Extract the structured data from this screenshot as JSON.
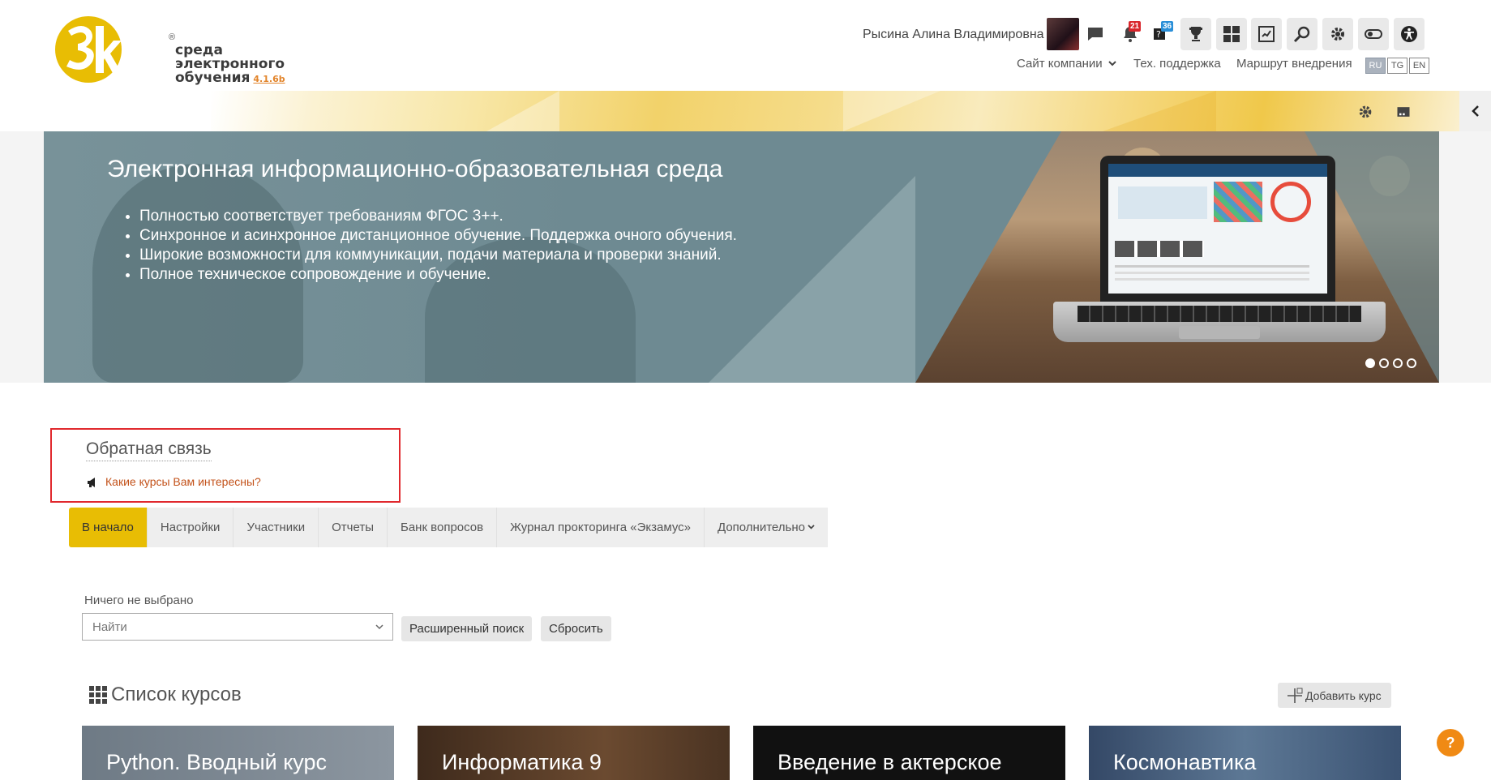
{
  "header": {
    "logo": {
      "line1": "среда",
      "line2": "электронного",
      "line3": "обучения",
      "version": "4.1.6b",
      "reg_mark": "®"
    },
    "user_name": "Рысина Алина Владимировна",
    "notifications_count": "21",
    "messages_count": "36",
    "nav": {
      "company_site": "Сайт компании",
      "tech_support": "Тех. поддержка",
      "implementation_route": "Маршрут внедрения"
    },
    "languages": [
      "RU",
      "TG",
      "EN"
    ],
    "active_language": "RU",
    "accent_color": "#e8bd04"
  },
  "banner": {
    "title": "Электронная информационно-образовательная среда",
    "bullets": [
      "Полностью соответствует требованиям ФГОС 3++.",
      "Синхронное и асинхронное дистанционное обучение. Поддержка очного обучения.",
      "Широкие возможности для коммуникации, подачи материала и проверки знаний.",
      "Полное техническое сопровождение и обучение."
    ],
    "slide_count": 4,
    "active_slide": 1
  },
  "feedback": {
    "title": "Обратная связь",
    "link": "Какие курсы Вам интересны?"
  },
  "tabs": [
    "В начало",
    "Настройки",
    "Участники",
    "Отчеты",
    "Банк вопросов",
    "Журнал прокторинга «Экзамус»",
    "Дополнительно"
  ],
  "search": {
    "label": "Ничего не выбрано",
    "placeholder": "Найти",
    "advanced_button": "Расширенный поиск",
    "reset_button": "Сбросить"
  },
  "courses": {
    "title": "Список курсов",
    "add_button": "Добавить курс",
    "items": [
      "Python. Вводный курс",
      "Информатика 9",
      "Введение в актерское",
      "Космонавтика"
    ]
  },
  "help_button": "?"
}
